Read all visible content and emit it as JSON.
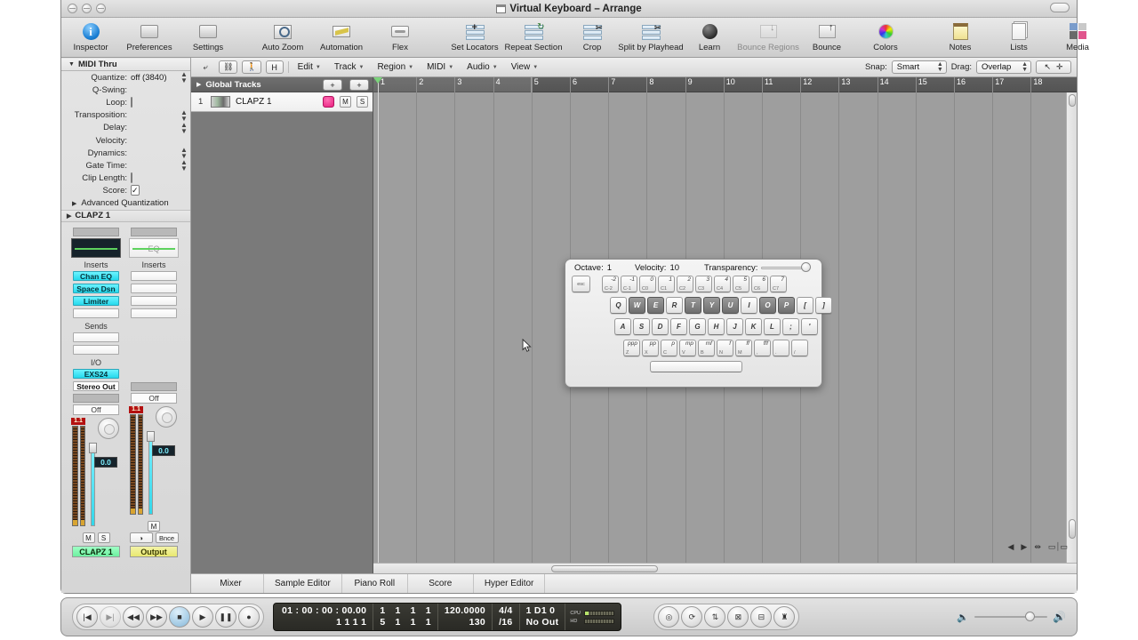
{
  "window": {
    "title": "Virtual Keyboard – Arrange",
    "title_icon": "window-document-icon"
  },
  "toolbar": {
    "groups": [
      {
        "items": [
          {
            "label": "Inspector",
            "icon": "info-icon",
            "dim": false
          },
          {
            "label": "Preferences",
            "icon": "preferences-icon",
            "dim": false
          },
          {
            "label": "Settings",
            "icon": "settings-icon",
            "dim": false
          }
        ]
      },
      {
        "items": [
          {
            "label": "Auto Zoom",
            "icon": "auto-zoom-icon",
            "dim": false
          },
          {
            "label": "Automation",
            "icon": "automation-icon",
            "dim": false
          },
          {
            "label": "Flex",
            "icon": "flex-icon",
            "dim": false
          }
        ]
      },
      {
        "items": [
          {
            "label": "Set Locators",
            "icon": "set-locators-icon",
            "dim": false
          },
          {
            "label": "Repeat Section",
            "icon": "repeat-section-icon",
            "dim": false
          },
          {
            "label": "Crop",
            "icon": "crop-icon",
            "dim": false
          },
          {
            "label": "Split by Playhead",
            "icon": "split-by-playhead-icon",
            "dim": false
          }
        ]
      },
      {
        "items": [
          {
            "label": "Learn",
            "icon": "learn-icon",
            "dim": false
          },
          {
            "label": "Bounce Regions",
            "icon": "bounce-regions-icon",
            "dim": true
          },
          {
            "label": "Bounce",
            "icon": "bounce-icon",
            "dim": false
          },
          {
            "label": "Colors",
            "icon": "colors-icon",
            "dim": false
          }
        ]
      },
      {
        "items": [
          {
            "label": "Notes",
            "icon": "notes-icon",
            "dim": false
          },
          {
            "label": "Lists",
            "icon": "lists-icon",
            "dim": false
          },
          {
            "label": "Media",
            "icon": "media-icon",
            "dim": false
          }
        ]
      }
    ]
  },
  "inspector": {
    "header": "MIDI Thru",
    "params": [
      {
        "label": "Quantize:",
        "value": "off (3840)",
        "control": "stepper"
      },
      {
        "label": "Q-Swing:",
        "value": "",
        "control": "none"
      },
      {
        "label": "Loop:",
        "value": "",
        "control": "checkbox",
        "checked": false
      },
      {
        "label": "Transposition:",
        "value": "",
        "control": "stepper"
      },
      {
        "label": "Delay:",
        "value": "",
        "control": "stepper"
      },
      {
        "label": "Velocity:",
        "value": "",
        "control": "none"
      },
      {
        "label": "Dynamics:",
        "value": "",
        "control": "stepper"
      },
      {
        "label": "Gate Time:",
        "value": "",
        "control": "stepper"
      },
      {
        "label": "Clip Length:",
        "value": "",
        "control": "checkbox",
        "checked": false
      },
      {
        "label": "Score:",
        "value": "",
        "control": "checkbox",
        "checked": true
      }
    ],
    "advanced_label": "Advanced Quantization",
    "channel_band": "CLAPZ 1",
    "strips": [
      {
        "eq_label": "",
        "inserts_label": "Inserts",
        "inserts": [
          "Chan EQ",
          "Space Dsn",
          "Limiter",
          ""
        ],
        "sends_label": "Sends",
        "sends": [
          "",
          ""
        ],
        "io_label": "I/O",
        "input": "EXS24",
        "output": "Stereo Out",
        "off_label": "Off",
        "peak": "1.1",
        "gain": "0.0",
        "buttons": [
          "M",
          "S"
        ],
        "name": "CLAPZ 1"
      },
      {
        "eq_label": "EQ",
        "inserts_label": "Inserts",
        "inserts": [
          "",
          "",
          "",
          ""
        ],
        "off_label": "Off",
        "peak": "1.1",
        "gain": "0.0",
        "buttons": [
          "M"
        ],
        "buttons2": [
          "◑",
          "Bnce"
        ],
        "name": "Output"
      }
    ]
  },
  "arrange_toolbar": {
    "left_buttons": [
      {
        "label": "",
        "icon": "pointer-tool-icon"
      },
      {
        "label": "",
        "icon": "link-chain-icon"
      },
      {
        "label": "",
        "icon": "walking-man-icon"
      },
      {
        "label": "H",
        "icon": "hide-tracks-icon"
      }
    ],
    "menus": [
      "Edit",
      "Track",
      "Region",
      "MIDI",
      "Audio",
      "View"
    ],
    "snap_label": "Snap:",
    "snap_value": "Smart",
    "drag_label": "Drag:",
    "drag_value": "Overlap",
    "tools": [
      "pointer-tool-icon",
      "crosshair-tool-icon"
    ]
  },
  "tracklist": {
    "global_tracks_label": "Global Tracks",
    "add_button": "+",
    "add_with_button": "+",
    "tracks": [
      {
        "number": "1",
        "name": "CLAPZ 1",
        "record": true,
        "mute": "M",
        "solo": "S"
      }
    ]
  },
  "ruler": {
    "ticks": [
      "1",
      "2",
      "3",
      "4",
      "5",
      "6",
      "7",
      "8",
      "9",
      "10",
      "11",
      "12",
      "13",
      "14",
      "15",
      "16",
      "17",
      "18"
    ]
  },
  "virtual_keyboard": {
    "octave_label": "Octave:",
    "octave_value": "1",
    "velocity_label": "Velocity:",
    "velocity_value": "10",
    "transparency_label": "Transparency:",
    "rows": {
      "number_row": [
        {
          "main": "esc",
          "type": "esc"
        },
        {
          "sup": "-2",
          "sub": "C-2",
          "type": "white"
        },
        {
          "sup": "-1",
          "sub": "C-1",
          "type": "white"
        },
        {
          "sup": "0",
          "sub": "C0",
          "type": "white"
        },
        {
          "sup": "1",
          "sub": "C1",
          "type": "white"
        },
        {
          "sup": "2",
          "sub": "C2",
          "type": "white"
        },
        {
          "sup": "3",
          "sub": "C3",
          "type": "white"
        },
        {
          "sup": "4",
          "sub": "C4",
          "type": "white"
        },
        {
          "sup": "5",
          "sub": "C5",
          "type": "white"
        },
        {
          "sup": "6",
          "sub": "C6",
          "type": "white"
        },
        {
          "sup": "7",
          "sub": "C7",
          "type": "white"
        }
      ],
      "qwerty_row": [
        {
          "main": "Q",
          "type": "white"
        },
        {
          "main": "W",
          "type": "black"
        },
        {
          "main": "E",
          "type": "black"
        },
        {
          "main": "R",
          "type": "white"
        },
        {
          "main": "T",
          "type": "black"
        },
        {
          "main": "Y",
          "type": "black"
        },
        {
          "main": "U",
          "type": "black"
        },
        {
          "main": "I",
          "type": "white"
        },
        {
          "main": "O",
          "type": "black"
        },
        {
          "main": "P",
          "type": "black"
        },
        {
          "main": "[",
          "type": "white"
        },
        {
          "main": "]",
          "type": "white"
        }
      ],
      "asdf_row": [
        {
          "main": "A",
          "type": "white"
        },
        {
          "main": "S",
          "type": "white"
        },
        {
          "main": "D",
          "type": "white"
        },
        {
          "main": "F",
          "type": "white"
        },
        {
          "main": "G",
          "type": "white"
        },
        {
          "main": "H",
          "type": "white"
        },
        {
          "main": "J",
          "type": "white"
        },
        {
          "main": "K",
          "type": "white"
        },
        {
          "main": "L",
          "type": "white"
        },
        {
          "main": ";",
          "type": "white"
        },
        {
          "main": "'",
          "type": "white"
        }
      ],
      "zxcv_row": [
        {
          "sup": "ppp",
          "sub": "Z",
          "type": "white",
          "pressed": true
        },
        {
          "sup": "pp",
          "sub": "X",
          "type": "white"
        },
        {
          "sup": "p",
          "sub": "C",
          "type": "white"
        },
        {
          "sup": "mp",
          "sub": "V",
          "type": "white"
        },
        {
          "sup": "mf",
          "sub": "B",
          "type": "white"
        },
        {
          "sup": "f",
          "sub": "N",
          "type": "white"
        },
        {
          "sup": "ff",
          "sub": "M",
          "type": "white"
        },
        {
          "sup": "fff",
          "sub": ",",
          "type": "white"
        },
        {
          "sup": "",
          "sub": ".",
          "type": "white"
        },
        {
          "sup": "",
          "sub": "/",
          "type": "white"
        }
      ],
      "space_label": ""
    }
  },
  "bottom_tabs": [
    "Mixer",
    "Sample Editor",
    "Piano Roll",
    "Score",
    "Hyper Editor"
  ],
  "transport": {
    "buttons": [
      {
        "name": "go-to-beginning-button",
        "glyph": "|◀",
        "state": "normal"
      },
      {
        "name": "go-to-end-button",
        "glyph": "▶|",
        "state": "dim"
      },
      {
        "name": "rewind-button",
        "glyph": "◀◀",
        "state": "normal"
      },
      {
        "name": "forward-button",
        "glyph": "▶▶",
        "state": "normal"
      },
      {
        "name": "stop-button",
        "glyph": "■",
        "state": "active"
      },
      {
        "name": "play-button",
        "glyph": "▶",
        "state": "normal"
      },
      {
        "name": "pause-button",
        "glyph": "❚❚",
        "state": "normal"
      },
      {
        "name": "record-button",
        "glyph": "●",
        "state": "normal"
      }
    ],
    "display": {
      "smpte_line1": "01 : 00 : 00 : 00.00",
      "smpte_line2": "1      1      1      1",
      "position_line1": [
        "1",
        "1",
        "1",
        "1"
      ],
      "position_line2": [
        "5",
        "1",
        "1",
        "1"
      ],
      "tempo_line1": "120.0000",
      "tempo_line2": "130",
      "signature_line1": "4/4",
      "signature_line2": "/16",
      "midi_line1": "1   D1           0",
      "midi_line2": "No Out",
      "cpu_label": "CPU",
      "hd_label": "HD"
    },
    "mode_buttons": [
      {
        "name": "click-metronome-button",
        "glyph": "◎"
      },
      {
        "name": "cycle-mode-button",
        "glyph": "⟳"
      },
      {
        "name": "autopunch-button",
        "glyph": "⇅"
      },
      {
        "name": "replace-mode-button",
        "glyph": "⊠"
      },
      {
        "name": "solo-button",
        "glyph": "⊟"
      },
      {
        "name": "metronome-button",
        "glyph": "♜"
      }
    ],
    "volume": {
      "min_icon": "speaker-low-icon",
      "max_icon": "speaker-high-icon"
    }
  }
}
